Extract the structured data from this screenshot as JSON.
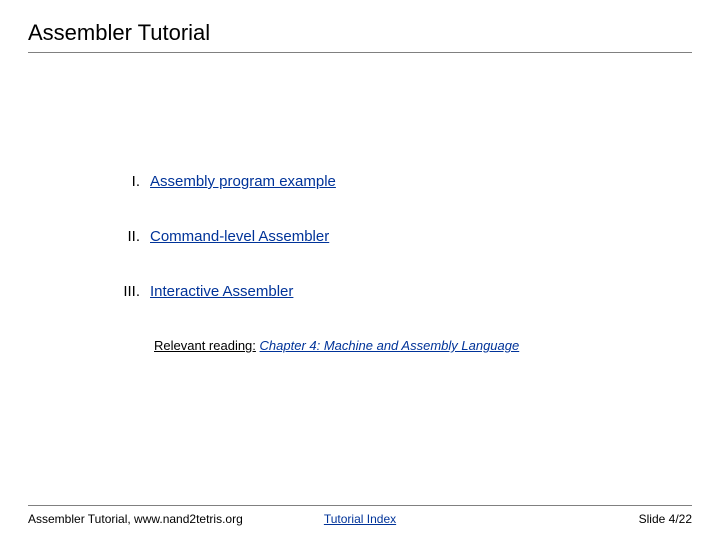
{
  "title": "Assembler Tutorial",
  "toc": [
    {
      "num": "I.",
      "label": "Assembly program example"
    },
    {
      "num": "II.",
      "label": "Command-level Assembler"
    },
    {
      "num": "III.",
      "label": "Interactive Assembler"
    }
  ],
  "reading": {
    "label": "Relevant reading:",
    "link": "Chapter 4: Machine and Assembly Language"
  },
  "footer": {
    "left": "Assembler Tutorial, www.nand2tetris.org",
    "center": "Tutorial Index",
    "right": "Slide 4/22"
  }
}
